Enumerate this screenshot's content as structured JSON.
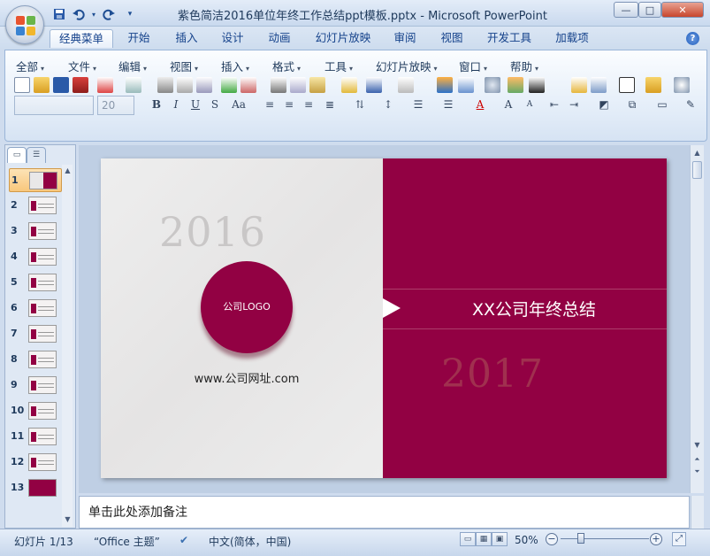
{
  "window": {
    "title": "紫色简洁2016单位年终工作总结ppt模板.pptx - Microsoft PowerPoint",
    "min_label": "—",
    "max_label": "□",
    "close_label": "✕"
  },
  "qat_icons": [
    "save-icon",
    "undo-icon",
    "redo-icon",
    "customize-icon"
  ],
  "tabs": [
    "经典菜单",
    "开始",
    "插入",
    "设计",
    "动画",
    "幻灯片放映",
    "审阅",
    "视图",
    "开发工具",
    "加载项"
  ],
  "active_tab": "经典菜单",
  "menu": [
    "全部",
    "文件",
    "编辑",
    "视图",
    "插入",
    "格式",
    "工具",
    "幻灯片放映",
    "窗口",
    "帮助"
  ],
  "font_size_value": "20",
  "font_name_value": "",
  "format_buttons": [
    "B",
    "I",
    "U",
    "S",
    "Aa"
  ],
  "slides": [
    {
      "num": "1"
    },
    {
      "num": "2"
    },
    {
      "num": "3"
    },
    {
      "num": "4"
    },
    {
      "num": "5"
    },
    {
      "num": "6"
    },
    {
      "num": "7"
    },
    {
      "num": "8"
    },
    {
      "num": "9"
    },
    {
      "num": "10"
    },
    {
      "num": "11"
    },
    {
      "num": "12"
    },
    {
      "num": "13"
    }
  ],
  "selected_slide": 1,
  "slide": {
    "year_left": "2016",
    "year_right": "2017",
    "logo_text": "公司LOGO",
    "website": "www.公司网址.com",
    "title": "XX公司年终总结",
    "accent_color": "#920143"
  },
  "notes_placeholder": "单击此处添加备注",
  "status": {
    "slide_info": "幻灯片 1/13",
    "theme": "“Office 主题”",
    "language": "中文(简体，中国)",
    "zoom": "50%"
  }
}
